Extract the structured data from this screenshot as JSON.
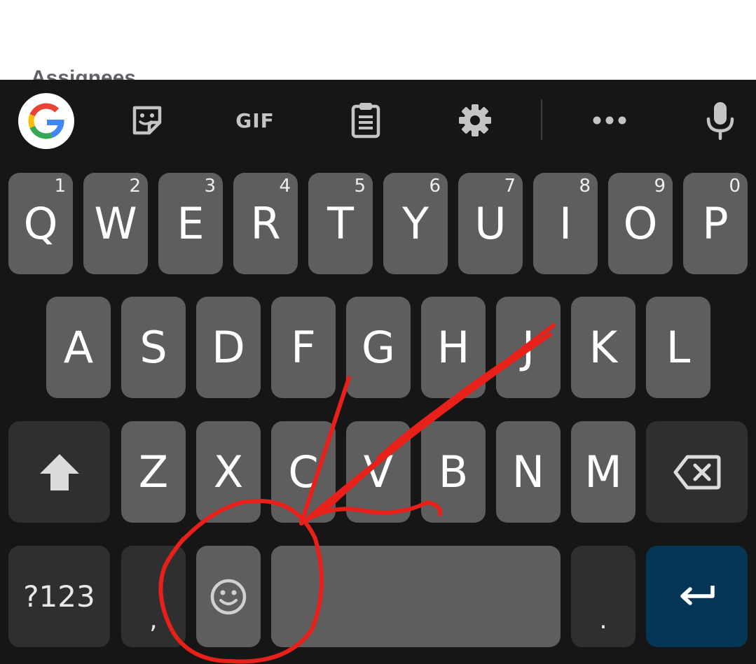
{
  "app": {
    "section_label": "Assignees"
  },
  "toolbar": {
    "items": [
      "google-logo",
      "sticker-icon",
      "GIF",
      "clipboard-icon",
      "gear-icon",
      "more-icon",
      "mic-icon"
    ],
    "gif_label": "GIF"
  },
  "keyboard": {
    "row1": [
      {
        "label": "Q",
        "hint": "1"
      },
      {
        "label": "W",
        "hint": "2"
      },
      {
        "label": "E",
        "hint": "3"
      },
      {
        "label": "R",
        "hint": "4"
      },
      {
        "label": "T",
        "hint": "5"
      },
      {
        "label": "Y",
        "hint": "6"
      },
      {
        "label": "U",
        "hint": "7"
      },
      {
        "label": "I",
        "hint": "8"
      },
      {
        "label": "O",
        "hint": "9"
      },
      {
        "label": "P",
        "hint": "0"
      }
    ],
    "row2": [
      "A",
      "S",
      "D",
      "F",
      "G",
      "H",
      "J",
      "K",
      "L"
    ],
    "row3": [
      "Z",
      "X",
      "C",
      "V",
      "B",
      "N",
      "M"
    ],
    "symbols_label": "?123",
    "comma_label": ",",
    "period_label": ".",
    "icons": {
      "shift": "shift-arrow-icon",
      "backspace": "backspace-icon",
      "emoji": "smiley-icon",
      "enter": "enter-arrow-icon"
    },
    "enter_color": "#053655"
  },
  "annotation": {
    "color": "#e8201a",
    "description": "hand-drawn circle and arrow"
  }
}
